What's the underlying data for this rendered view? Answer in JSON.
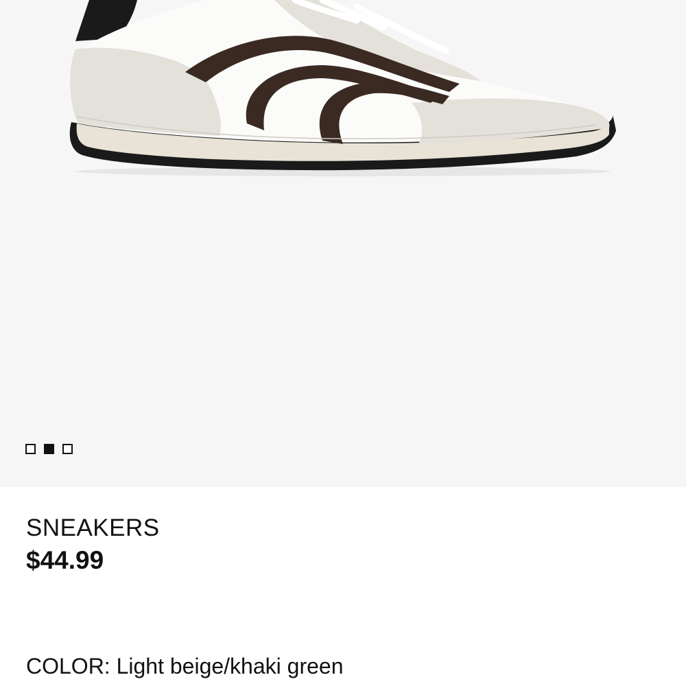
{
  "gallery": {
    "image_alt": "sneaker",
    "dots": [
      {
        "active": false
      },
      {
        "active": true
      },
      {
        "active": false
      }
    ]
  },
  "product": {
    "title": "SNEAKERS",
    "price": "$44.99",
    "color_label": "COLOR:",
    "color_value": "Light beige/khaki green"
  },
  "colors": {
    "gallery_bg": "#f6f6f6",
    "text": "#111111",
    "stripe_brown": "#3a2a22",
    "suede_beige": "#e4e1da",
    "upper_white": "#fbfbfa",
    "sole_black": "#1a1a1a"
  }
}
